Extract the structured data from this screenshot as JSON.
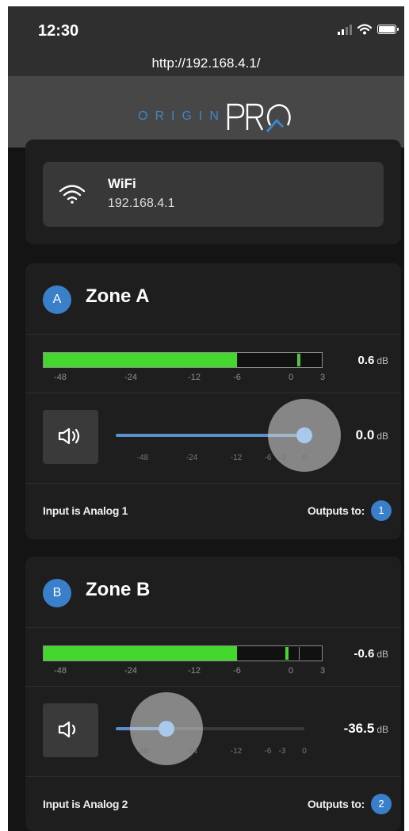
{
  "status_bar": {
    "time": "12:30"
  },
  "browser": {
    "url": "http://192.168.4.1/"
  },
  "logo": {
    "text": "ORIGIN",
    "mark": "PRO"
  },
  "wifi": {
    "label": "WiFi",
    "ip": "192.168.4.1",
    "icon": "wifi-icon"
  },
  "meter_ticks": [
    "-48",
    "-24",
    "-12",
    "-6",
    "0",
    "3"
  ],
  "slider_ticks": [
    "-48",
    "-24",
    "-12",
    "-6",
    "-3",
    "0"
  ],
  "zones": [
    {
      "badge": "A",
      "title": "Zone A",
      "meter_value": "0.6",
      "meter_unit": "dB",
      "meter_level_db": 0.6,
      "volume_value": "0.0",
      "volume_unit": "dB",
      "volume_level_db": 0.0,
      "input_label": "Input is Analog 1",
      "outputs_label": "Outputs to:",
      "output_badge": "1",
      "mute_icon": "speaker-on-icon"
    },
    {
      "badge": "B",
      "title": "Zone B",
      "meter_value": "-0.6",
      "meter_unit": "dB",
      "meter_level_db": -0.6,
      "volume_value": "-36.5",
      "volume_unit": "dB",
      "volume_level_db": -36.5,
      "input_label": "Input is Analog 2",
      "outputs_label": "Outputs to:",
      "output_badge": "2",
      "mute_icon": "speaker-low-icon"
    }
  ],
  "colors": {
    "accent": "#3a7fc9",
    "meter_green": "#44d82f",
    "slider_fill": "#5b8fc9"
  }
}
